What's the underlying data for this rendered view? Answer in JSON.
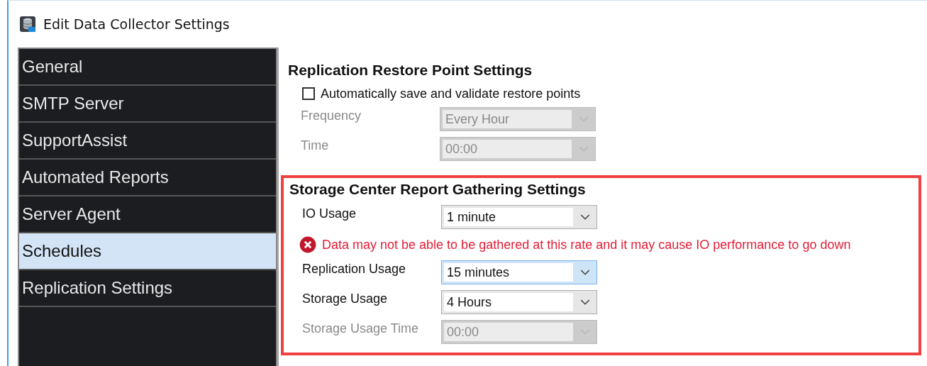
{
  "window": {
    "title": "Edit Data Collector Settings"
  },
  "sidebar": {
    "items": [
      {
        "label": "General",
        "selected": false
      },
      {
        "label": "SMTP Server",
        "selected": false
      },
      {
        "label": "SupportAssist",
        "selected": false
      },
      {
        "label": "Automated Reports",
        "selected": false
      },
      {
        "label": "Server Agent",
        "selected": false
      },
      {
        "label": "Schedules",
        "selected": true
      },
      {
        "label": "Replication Settings",
        "selected": false
      }
    ]
  },
  "sections": [
    {
      "title": "Replication Restore Point Settings",
      "highlighted": false,
      "rows": [
        {
          "kind": "checkbox",
          "label": "Automatically save and validate restore points",
          "checked": false
        },
        {
          "kind": "dropdown",
          "label": "Frequency",
          "value": "Every Hour",
          "disabled": true,
          "hovered": false
        },
        {
          "kind": "dropdown",
          "label": "Time",
          "value": "00:00",
          "disabled": true,
          "hovered": false
        }
      ]
    },
    {
      "title": "Storage Center Report Gathering Settings",
      "highlighted": true,
      "rows": [
        {
          "kind": "dropdown",
          "label": "IO Usage",
          "value": "1 minute",
          "disabled": false,
          "hovered": false
        },
        {
          "kind": "error",
          "text": "Data may not be able to be gathered at this rate and it may cause IO performance to go down"
        },
        {
          "kind": "dropdown",
          "label": "Replication Usage",
          "value": "15 minutes",
          "disabled": false,
          "hovered": true
        },
        {
          "kind": "dropdown",
          "label": "Storage Usage",
          "value": "4 Hours",
          "disabled": false,
          "hovered": false
        },
        {
          "kind": "dropdown",
          "label": "Storage Usage Time",
          "value": "00:00",
          "disabled": true,
          "hovered": false
        }
      ]
    }
  ]
}
